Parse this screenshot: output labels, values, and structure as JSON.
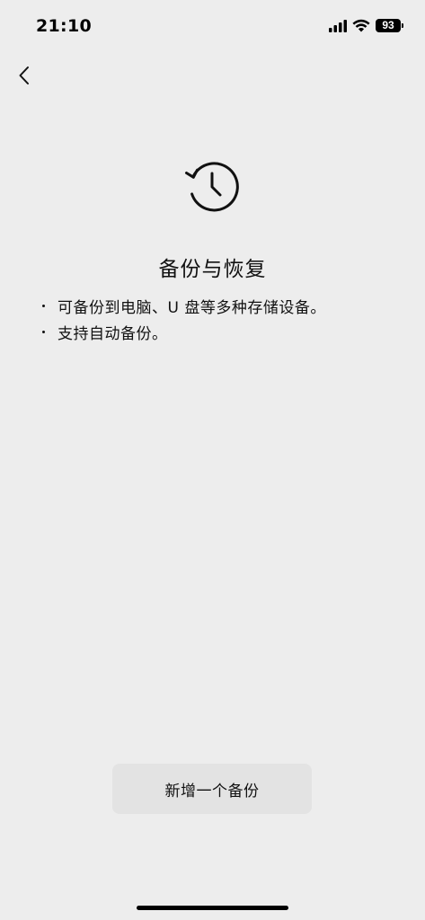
{
  "status_bar": {
    "time": "21:10",
    "battery_level": "93",
    "icons": [
      "signal-icon",
      "wifi-icon",
      "battery-icon"
    ]
  },
  "nav": {
    "back_icon": "chevron-left-icon"
  },
  "hero": {
    "icon": "history-clock-icon",
    "title": "备份与恢复"
  },
  "features": [
    "可备份到电脑、U 盘等多种存储设备。",
    "支持自动备份。"
  ],
  "actions": {
    "add_backup_label": "新增一个备份"
  },
  "colors": {
    "background": "#ededed",
    "button_background": "#e3e3e3",
    "text": "#111111"
  }
}
